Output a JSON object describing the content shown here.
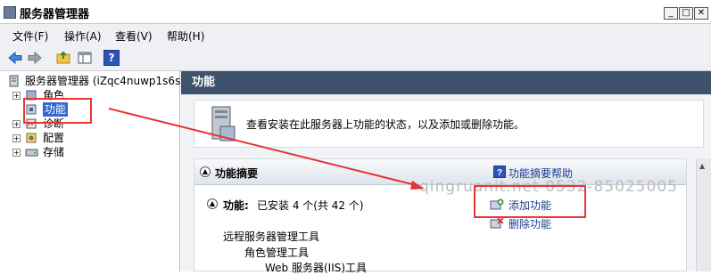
{
  "window": {
    "title": "服务器管理器",
    "minimize": "_",
    "maximize": "□",
    "close": "✕"
  },
  "menu": [
    "文件(F)",
    "操作(A)",
    "查看(V)",
    "帮助(H)"
  ],
  "toolbar": {
    "help": "?"
  },
  "tree": {
    "root": "服务器管理器 (iZqc4nuwp1s6ss",
    "items": [
      {
        "label": "角色"
      },
      {
        "label": "功能"
      },
      {
        "label": "诊断"
      },
      {
        "label": "配置"
      },
      {
        "label": "存储"
      }
    ]
  },
  "panel": {
    "header": "功能",
    "description": "查看安装在此服务器上功能的状态，以及添加或删除功能。",
    "summary_title": "功能摘要",
    "help_link": "功能摘要帮助",
    "installed_label": "功能:",
    "installed_text": "已安装 4 个(共 42 个)",
    "add_link": "添加功能",
    "remove_link": "删除功能",
    "features": [
      "远程服务器管理工具",
      "角色管理工具",
      "Web 服务器(IIS)工具"
    ]
  },
  "watermark": "qingruanit.net 0532-85025005",
  "colors": {
    "header_bg": "#3e536b",
    "link": "#1a3e8c",
    "annotation": "#e33333"
  }
}
